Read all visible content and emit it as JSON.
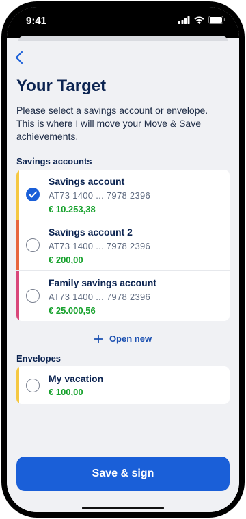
{
  "status": {
    "time": "9:41"
  },
  "header": {
    "title": "Your Target",
    "subtitle": "Please select a savings account or envelope. This is where I will move your Move & Save achievements."
  },
  "savings": {
    "label": "Savings accounts",
    "accounts": [
      {
        "name": "Savings account",
        "iban": "AT73 1400 ... 7978 2396",
        "balance": "€ 10.253,38",
        "accent": "#f5c842",
        "selected": true
      },
      {
        "name": "Savings account 2",
        "iban": "AT73 1400 ... 7978 2396",
        "balance": "€ 200,00",
        "accent": "#e8663d",
        "selected": false
      },
      {
        "name": "Family savings account",
        "iban": "AT73 1400 ... 7978 2396",
        "balance": "€ 25.000,56",
        "accent": "#d9477a",
        "selected": false
      }
    ],
    "open_new": "Open new"
  },
  "envelopes": {
    "label": "Envelopes",
    "items": [
      {
        "name": "My vacation",
        "balance": "€ 100,00",
        "accent": "#f5c842",
        "selected": false
      }
    ]
  },
  "actions": {
    "save_sign": "Save & sign"
  },
  "colors": {
    "primary": "#1a5fd8",
    "title": "#0c2451",
    "balance_green": "#16a12c",
    "background": "#f0f1f4"
  }
}
